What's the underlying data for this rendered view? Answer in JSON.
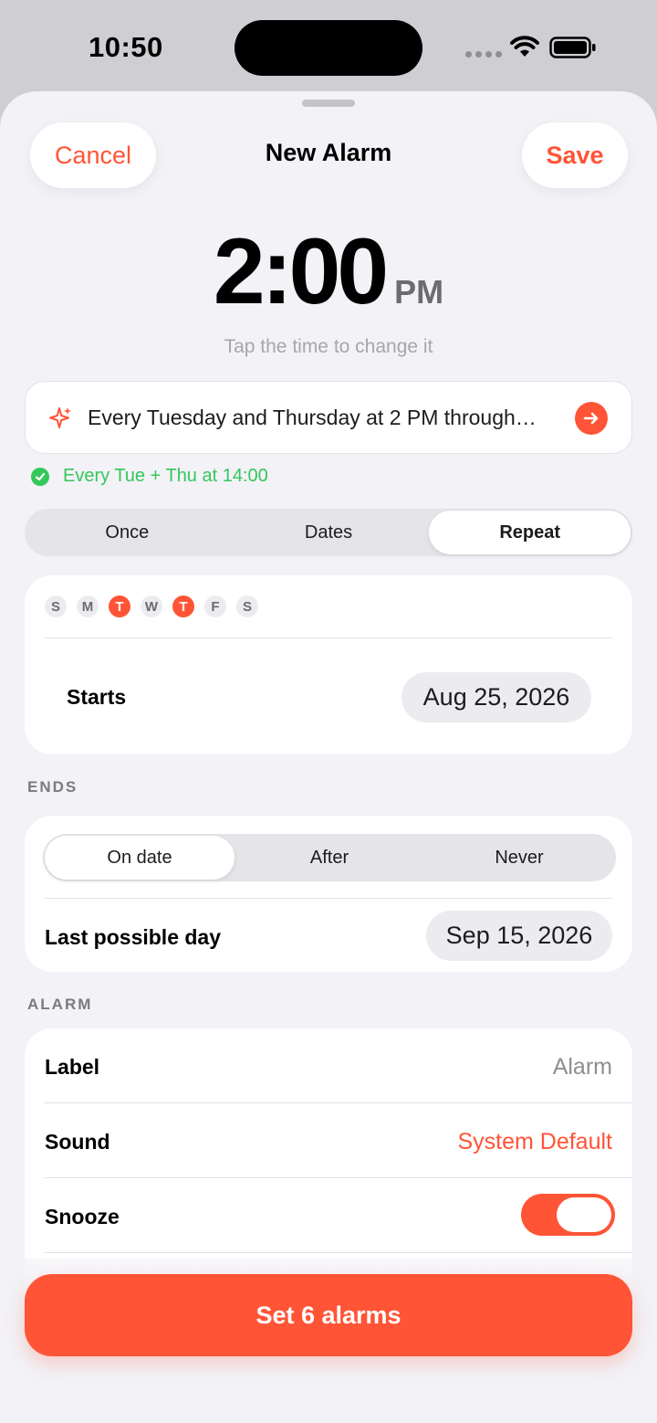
{
  "status_bar": {
    "time": "10:50",
    "icons": [
      "signal-dots-icon",
      "wifi-icon",
      "battery-icon"
    ]
  },
  "sheet": {
    "title": "New Alarm",
    "cancel_label": "Cancel",
    "save_label": "Save"
  },
  "alarm_time": {
    "time": "2:00",
    "period": "PM",
    "hint": "Tap the time to change it"
  },
  "nl_input": {
    "value": "Every Tuesday and Thursday at 2 PM through…",
    "icon": "sparkle-icon",
    "submit_icon": "arrow-right-icon"
  },
  "parsed": {
    "text": "Every Tue + Thu at 14:00",
    "icon": "check-circle-icon"
  },
  "mode_tabs": {
    "options": [
      "Once",
      "Dates",
      "Repeat"
    ],
    "selected": "Repeat"
  },
  "repeat": {
    "days": [
      {
        "letter": "S",
        "on": false
      },
      {
        "letter": "M",
        "on": false
      },
      {
        "letter": "T",
        "on": true
      },
      {
        "letter": "W",
        "on": false
      },
      {
        "letter": "T",
        "on": true
      },
      {
        "letter": "F",
        "on": false
      },
      {
        "letter": "S",
        "on": false
      }
    ],
    "starts_label": "Starts",
    "starts_value": "Aug 25, 2026"
  },
  "ends": {
    "header": "ENDS",
    "options": [
      "On date",
      "After",
      "Never"
    ],
    "selected": "On date",
    "last_day_label": "Last possible day",
    "last_day_value": "Sep 15, 2026"
  },
  "alarm": {
    "header": "ALARM",
    "label_label": "Label",
    "label_value": "Alarm",
    "sound_label": "Sound",
    "sound_value": "System Default",
    "snooze_label": "Snooze",
    "snooze_on": true
  },
  "cta": {
    "label": "Set 6 alarms"
  },
  "colors": {
    "accent": "#ff5436",
    "success": "#34c759",
    "background": "#f2f2f7"
  }
}
